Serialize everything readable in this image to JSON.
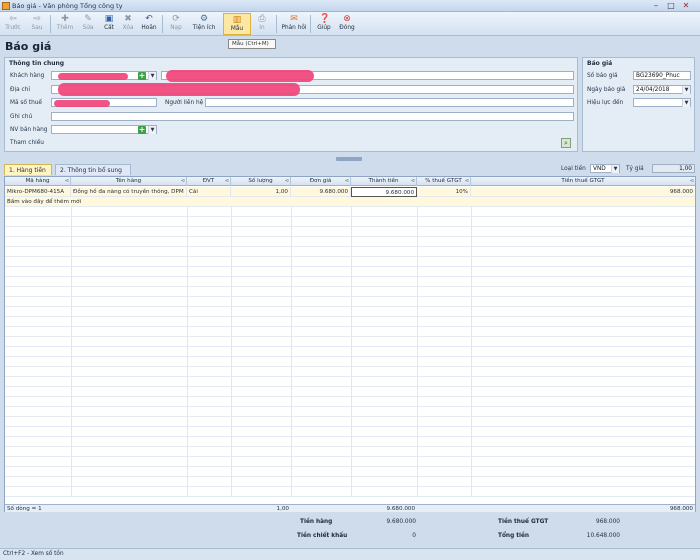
{
  "window": {
    "title": "Báo giá - Văn phòng Tổng công ty"
  },
  "toolbar": {
    "items": [
      {
        "label": "Trước",
        "icon": "arrow-left-icon"
      },
      {
        "label": "Sau",
        "icon": "arrow-right-icon"
      },
      {
        "label": "Thêm",
        "icon": "add-icon"
      },
      {
        "label": "Sửa",
        "icon": "edit-icon"
      },
      {
        "label": "Cất",
        "icon": "save-icon"
      },
      {
        "label": "Xóa",
        "icon": "delete-icon"
      },
      {
        "label": "Hoãn",
        "icon": "undo-icon"
      },
      {
        "label": "Nạp",
        "icon": "refresh-icon"
      },
      {
        "label": "Tiện ích",
        "icon": "gear-icon"
      },
      {
        "label": "Mẫu",
        "icon": "chart-icon"
      },
      {
        "label": "In",
        "icon": "print-icon"
      },
      {
        "label": "Phản hồi",
        "icon": "mail-icon"
      },
      {
        "label": "Giúp",
        "icon": "help-icon"
      },
      {
        "label": "Đóng",
        "icon": "close-icon"
      }
    ]
  },
  "tooltip": "Mẫu (Ctrl+M)",
  "page_title": "Báo giá",
  "general": {
    "title": "Thông tin chung",
    "customer_label": "Khách hàng",
    "address_label": "Địa chỉ",
    "tax_label": "Mã số thuế",
    "contact_label": "Người liên hệ",
    "note_label": "Ghi chú",
    "staff_label": "NV bán hàng",
    "ref_label": "Tham chiếu"
  },
  "quote": {
    "title": "Báo giá",
    "number_label": "Số báo giá",
    "number": "BG23690_Phuc",
    "date_label": "Ngày báo giá",
    "date": "24/04/2018",
    "valid_label": "Hiệu lực đến",
    "valid": ""
  },
  "tabs": [
    "1. Hàng tiền",
    "2. Thông tin bổ sung"
  ],
  "currency": {
    "label": "Loại tiền",
    "value": "VND",
    "rate_label": "Tỷ giá",
    "rate": "1,00"
  },
  "grid": {
    "columns": [
      "Mã hàng",
      "Tên hàng",
      "ĐVT",
      "Số lượng",
      "Đơn giá",
      "Thành tiền",
      "% thuế GTGT",
      "Tiền thuế GTGT"
    ],
    "rows": [
      [
        "Mikro-DPM680-415A",
        "Đồng hồ đa năng có truyền thông, DPM",
        "Cái",
        "1,00",
        "9.680.000",
        "9.680.000",
        "10%",
        "968.000"
      ]
    ],
    "add_hint": "Bấm vào đây để thêm mới",
    "footer": {
      "count": "Số dòng = 1",
      "qty": "1,00",
      "amount": "9.680.000",
      "tax": "968.000"
    }
  },
  "totals": {
    "goods_label": "Tiền hàng",
    "goods": "9.680.000",
    "discount_label": "Tiền chiết khấu",
    "discount": "0",
    "tax_label": "Tiền thuế GTGT",
    "tax": "968.000",
    "total_label": "Tổng tiền",
    "total": "10.648.000"
  },
  "status": "Ctrl+F2 - Xem số tồn"
}
